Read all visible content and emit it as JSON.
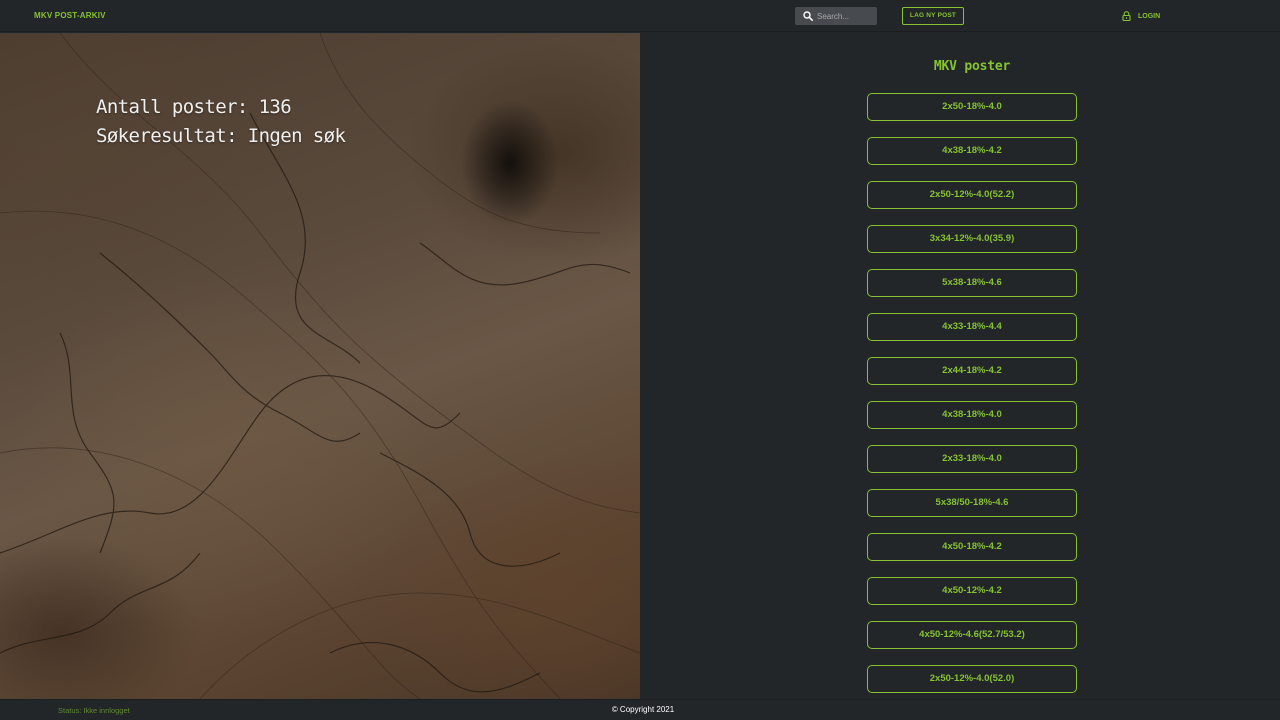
{
  "navbar": {
    "brand": "MKV POST-ARKIV",
    "search_placeholder": "Search...",
    "new_post_label": "LAG NY POST",
    "login_label": "LOGIN"
  },
  "hero": {
    "post_count_line": "Antall poster: 136",
    "search_result_line": "Søkeresultat: Ingen søk"
  },
  "posts": {
    "title": "MKV poster",
    "items": [
      "2x50-18%-4.0",
      "4x38-18%-4.2",
      "2x50-12%-4.0(52.2)",
      "3x34-12%-4.0(35.9)",
      "5x38-18%-4.6",
      "4x33-18%-4.4",
      "2x44-18%-4.2",
      "4x38-18%-4.0",
      "2x33-18%-4.0",
      "5x38/50-18%-4.6",
      "4x50-18%-4.2",
      "4x50-12%-4.2",
      "4x50-12%-4.6(52.7/53.2)",
      "2x50-12%-4.0(52.0)"
    ]
  },
  "footer": {
    "status": "Status: Ikke innlogget",
    "copyright": "© Copyright 2021"
  },
  "colors": {
    "accent": "#86c232",
    "background": "#222629",
    "search_bg": "#474b4f"
  },
  "icons": {
    "search": "search-icon",
    "login": "lock-icon"
  }
}
